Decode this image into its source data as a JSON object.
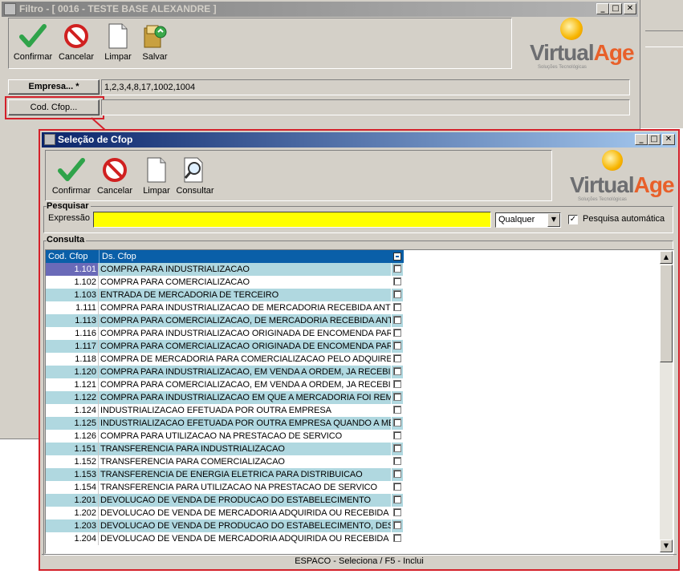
{
  "filtro": {
    "title": "Filtro - [ 0016 - TESTE BASE ALEXANDRE ]",
    "toolbar": {
      "confirmar": "Confirmar",
      "cancelar": "Cancelar",
      "limpar": "Limpar",
      "salvar": "Salvar"
    },
    "empresa_label": "Empresa... *",
    "empresa_value": "1,2,3,4,8,17,1002,1004",
    "cfop_label": "Cod. Cfop...",
    "cfop_value": ""
  },
  "logo": {
    "virtual": "Virtual",
    "age": "Age",
    "tagline": "Soluções Tecnológicas"
  },
  "dialog": {
    "title": "Seleção de Cfop",
    "toolbar": {
      "confirmar": "Confirmar",
      "cancelar": "Cancelar",
      "limpar": "Limpar",
      "consultar": "Consultar"
    },
    "pesquisar_title": "Pesquisar",
    "expressao_label": "Expressão",
    "expressao_value": "",
    "match_select": "Qualquer",
    "auto_search_label": "Pesquisa automática",
    "auto_search_checked": true,
    "consulta_title": "Consulta",
    "columns": [
      "Cod. Cfop",
      "Ds. Cfop"
    ],
    "rows": [
      {
        "code": "1.101",
        "desc": "COMPRA PARA INDUSTRIALIZACAO"
      },
      {
        "code": "1.102",
        "desc": "COMPRA PARA COMERCIALIZACAO"
      },
      {
        "code": "1.103",
        "desc": "ENTRADA DE MERCADORIA DE TERCEIRO"
      },
      {
        "code": "1.111",
        "desc": "COMPRA PARA INDUSTRIALIZACAO DE MERCADORIA RECEBIDA ANTI"
      },
      {
        "code": "1.113",
        "desc": "COMPRA PARA COMERCIALIZACAO, DE MERCADORIA RECEBIDA ANTE"
      },
      {
        "code": "1.116",
        "desc": "COMPRA PARA INDUSTRIALIZACAO ORIGINADA DE ENCOMENDA PAR"
      },
      {
        "code": "1.117",
        "desc": "COMPRA PARA COMERCIALIZACAO ORIGINADA DE ENCOMENDA PARA"
      },
      {
        "code": "1.118",
        "desc": "COMPRA DE MERCADORIA PARA COMERCIALIZACAO PELO ADQUIREN"
      },
      {
        "code": "1.120",
        "desc": "COMPRA PARA INDUSTRIALIZACAO, EM VENDA A ORDEM, JA RECEBI"
      },
      {
        "code": "1.121",
        "desc": "COMPRA PARA COMERCIALIZACAO, EM VENDA A ORDEM, JA RECEBID"
      },
      {
        "code": "1.122",
        "desc": "COMPRA PARA INDUSTRIALIZACAO EM QUE A MERCADORIA FOI REM"
      },
      {
        "code": "1.124",
        "desc": "INDUSTRIALIZACAO EFETUADA POR OUTRA EMPRESA"
      },
      {
        "code": "1.125",
        "desc": "INDUSTRIALIZACAO EFETUADA POR OUTRA EMPRESA QUANDO A ME"
      },
      {
        "code": "1.126",
        "desc": "COMPRA PARA UTILIZACAO NA PRESTACAO DE SERVICO"
      },
      {
        "code": "1.151",
        "desc": "TRANSFERENCIA PARA INDUSTRIALIZACAO"
      },
      {
        "code": "1.152",
        "desc": "TRANSFERENCIA PARA COMERCIALIZACAO"
      },
      {
        "code": "1.153",
        "desc": "TRANSFERENCIA DE ENERGIA ELETRICA PARA DISTRIBUICAO"
      },
      {
        "code": "1.154",
        "desc": "TRANSFERENCIA PARA UTILIZACAO NA PRESTACAO DE SERVICO"
      },
      {
        "code": "1.201",
        "desc": "DEVOLUCAO DE VENDA DE PRODUCAO DO ESTABELECIMENTO"
      },
      {
        "code": "1.202",
        "desc": "DEVOLUCAO DE VENDA DE MERCADORIA ADQUIRIDA OU RECEBIDA D"
      },
      {
        "code": "1.203",
        "desc": "DEVOLUCAO DE VENDA DE PRODUCAO DO ESTABELECIMENTO, DEST"
      },
      {
        "code": "1.204",
        "desc": "DEVOLUCAO DE VENDA DE MERCADORIA ADQUIRIDA OU RECEBIDA D"
      }
    ],
    "status": "ESPACO - Seleciona / F5 - Inclui"
  },
  "colors": {
    "highlight": "#d4202a",
    "row_alt": "#b0d8e0",
    "header": "#0a5fa8",
    "search_bg": "#ffff00"
  }
}
